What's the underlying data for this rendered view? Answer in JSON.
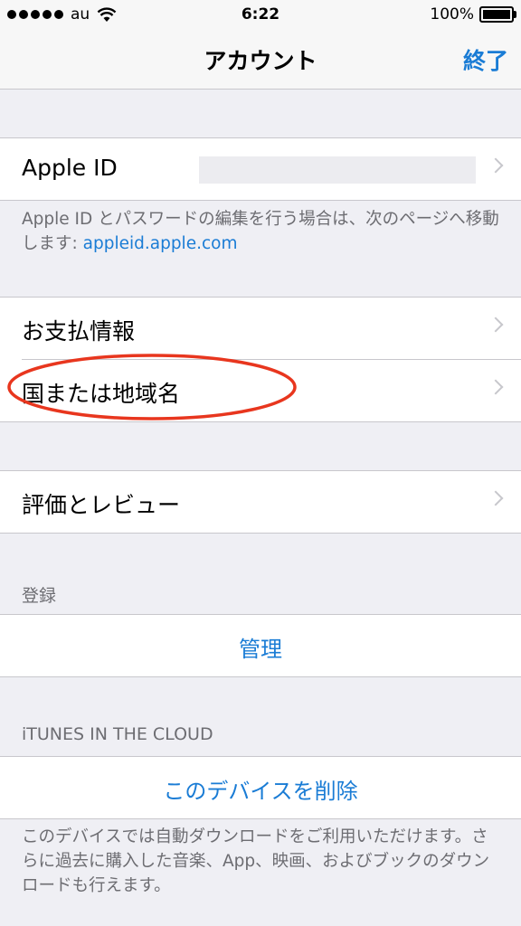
{
  "status_bar": {
    "carrier": "au",
    "time": "6:22",
    "battery": "100%",
    "icons": [
      "signal-dots-icon",
      "wifi-icon",
      "battery-icon"
    ]
  },
  "nav": {
    "title": "アカウント",
    "done_label": "終了"
  },
  "apple_id": {
    "label": "Apple ID",
    "value": ""
  },
  "apple_id_note": {
    "text": "Apple ID とパスワードの編集を行う場合は、次のページへ移動します: ",
    "link": "appleid.apple.com"
  },
  "settings": {
    "payment": "お支払情報",
    "country": "国または地域名"
  },
  "ratings": {
    "label": "評価とレビュー"
  },
  "subscriptions": {
    "header": "登録",
    "manage": "管理"
  },
  "itunes_cloud": {
    "header": "iTUNES IN THE CLOUD",
    "remove_device": "このデバイスを削除",
    "note": "このデバイスでは自動ダウンロードをご利用いただけます。さらに過去に購入した音楽、App、映画、およびブックのダウンロードも行えます。"
  },
  "colors": {
    "accent": "#1a7cd5",
    "background": "#efeff4",
    "annotation": "#e8361e"
  }
}
